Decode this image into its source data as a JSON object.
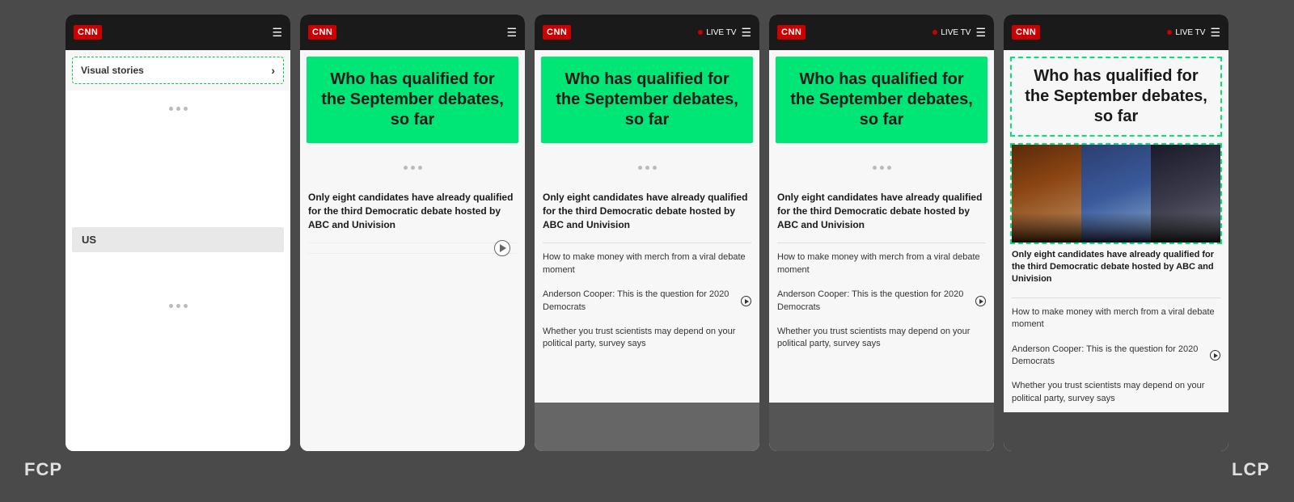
{
  "background_color": "#4a4a4a",
  "phones": [
    {
      "id": "phone1",
      "header": {
        "logo": "CNN",
        "show_live_tv": false
      },
      "content_type": "visual_stories",
      "visual_stories_label": "Visual stories",
      "section_label": "US"
    },
    {
      "id": "phone2",
      "header": {
        "logo": "CNN",
        "show_live_tv": false
      },
      "content_type": "article",
      "article_title": "Who has qualified for the September debates, so far",
      "article_headline": "Only eight candidates have already qualified for the third Democratic debate hosted by ABC and Univision",
      "sub_articles": []
    },
    {
      "id": "phone3",
      "header": {
        "logo": "CNN",
        "show_live_tv": true,
        "live_tv_label": "LIVE TV"
      },
      "content_type": "article_full",
      "article_title": "Who has qualified for the September debates, so far",
      "article_headline": "Only eight candidates have already qualified for the third Democratic debate hosted by ABC and Univision",
      "sub_articles": [
        "How to make money with merch from a viral debate moment",
        "Anderson Cooper: This is the question for 2020 Democrats",
        "Whether you trust scientists may depend on your political party, survey says"
      ],
      "has_bottom_image": true
    },
    {
      "id": "phone4",
      "header": {
        "logo": "CNN",
        "show_live_tv": true,
        "live_tv_label": "LIVE TV"
      },
      "content_type": "article_full",
      "article_title": "Who has qualified for the September debates, so far",
      "article_headline": "Only eight candidates have already qualified for the third Democratic debate hosted by ABC and Univision",
      "sub_articles": [
        "How to make money with merch from a viral debate moment",
        "Anderson Cooper: This is the question for 2020 Democrats",
        "Whether you trust scientists may depend on your political party, survey says"
      ],
      "has_bottom_image": true
    },
    {
      "id": "phone5",
      "header": {
        "logo": "CNN",
        "show_live_tv": true,
        "live_tv_label": "LIVE TV"
      },
      "content_type": "article_full_image",
      "article_title": "Who has qualified for the September debates, so far",
      "article_headline": "Only eight candidates have already qualified for the third Democratic debate hosted by ABC and Univision",
      "sub_articles": [
        "How to make money with merch from a viral debate moment",
        "Anderson Cooper: This is the question for 2020 Democrats",
        "Whether you trust scientists may depend on your political party, survey says"
      ],
      "has_politician_image": true,
      "has_bottom_image": true
    }
  ],
  "labels": {
    "fcp": "FCP",
    "lcp": "LCP"
  }
}
